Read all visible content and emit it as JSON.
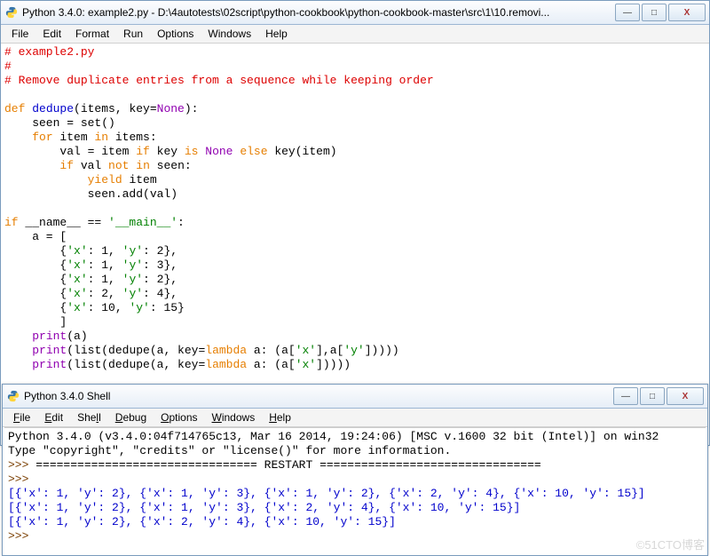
{
  "editor": {
    "title": "Python 3.4.0: example2.py - D:\\4autotests\\02script\\python-cookbook\\python-cookbook-master\\src\\1\\10.removi...",
    "menus": [
      "File",
      "Edit",
      "Format",
      "Run",
      "Options",
      "Windows",
      "Help"
    ],
    "code": {
      "l1": "# example2.py",
      "l2": "#",
      "l3": "# Remove duplicate entries from a sequence while keeping order",
      "kw_def": "def",
      "fn_dedupe": "dedupe",
      "params_open": "(items, key=",
      "kw_none1": "None",
      "params_close": "):",
      "seen_eq": "    seen = set()",
      "kw_for": "for",
      "for_mid": " item ",
      "kw_in1": "in",
      "for_end": " items:",
      "val_pre": "        val = item ",
      "kw_if1": "if",
      "val_mid1": " key ",
      "kw_is": "is",
      "val_mid2": " ",
      "kw_none2": "None",
      "val_mid3": " ",
      "kw_else": "else",
      "val_end": " key(item)",
      "if2_pre": "        ",
      "kw_if2": "if",
      "if2_mid": " val ",
      "kw_not": "not",
      "if2_mid2": " ",
      "kw_in2": "in",
      "if2_end": " seen:",
      "yield_pre": "            ",
      "kw_yield": "yield",
      "yield_end": " item",
      "seen_add": "            seen.add(val)",
      "ifname_pre": "",
      "kw_if3": "if",
      "ifname_mid": " __name__ == ",
      "str_main": "'__main__'",
      "ifname_end": ":",
      "a_open": "    a = [",
      "d1a": "        {",
      "d1k1": "'x'",
      "d1v1": ": 1, ",
      "d1k2": "'y'",
      "d1v2": ": 2},",
      "d2a": "        {",
      "d2k1": "'x'",
      "d2v1": ": 1, ",
      "d2k2": "'y'",
      "d2v2": ": 3},",
      "d3a": "        {",
      "d3k1": "'x'",
      "d3v1": ": 1, ",
      "d3k2": "'y'",
      "d3v2": ": 2},",
      "d4a": "        {",
      "d4k1": "'x'",
      "d4v1": ": 2, ",
      "d4k2": "'y'",
      "d4v2": ": 4},",
      "d5a": "        {",
      "d5k1": "'x'",
      "d5v1": ": 10, ",
      "d5k2": "'y'",
      "d5v2": ": 15}",
      "a_close": "        ]",
      "print_pre": "    ",
      "kw_print1": "print",
      "print_a": "(a)",
      "kw_print2": "print",
      "p2a": "(list(dedupe(a, key=",
      "kw_lambda1": "lambda",
      "p2b": " a: (a[",
      "p2kx": "'x'",
      "p2c": "],a[",
      "p2ky": "'y'",
      "p2d": "]))))",
      "kw_print3": "print",
      "p3a": "(list(dedupe(a, key=",
      "kw_lambda2": "lambda",
      "p3b": " a: (a[",
      "p3kx": "'x'",
      "p3d": "]))))"
    }
  },
  "shell": {
    "title": "Python 3.4.0 Shell",
    "menus": [
      "File",
      "Edit",
      "Shell",
      "Debug",
      "Options",
      "Windows",
      "Help"
    ],
    "banner1": "Python 3.4.0 (v3.4.0:04f714765c13, Mar 16 2014, 19:24:06) [MSC v.1600 32 bit (Intel)] on win32",
    "banner2": "Type \"copyright\", \"credits\" or \"license()\" for more information.",
    "prompt": ">>> ",
    "restart": "================================ RESTART ================================",
    "out1": "[{'x': 1, 'y': 2}, {'x': 1, 'y': 3}, {'x': 1, 'y': 2}, {'x': 2, 'y': 4}, {'x': 10, 'y': 15}]",
    "out2": "[{'x': 1, 'y': 2}, {'x': 1, 'y': 3}, {'x': 2, 'y': 4}, {'x': 10, 'y': 15}]",
    "out3": "[{'x': 1, 'y': 2}, {'x': 2, 'y': 4}, {'x': 10, 'y': 15}]"
  },
  "watermark": "©51CTO博客",
  "window_controls": {
    "min": "—",
    "max": "□",
    "close": "X"
  }
}
